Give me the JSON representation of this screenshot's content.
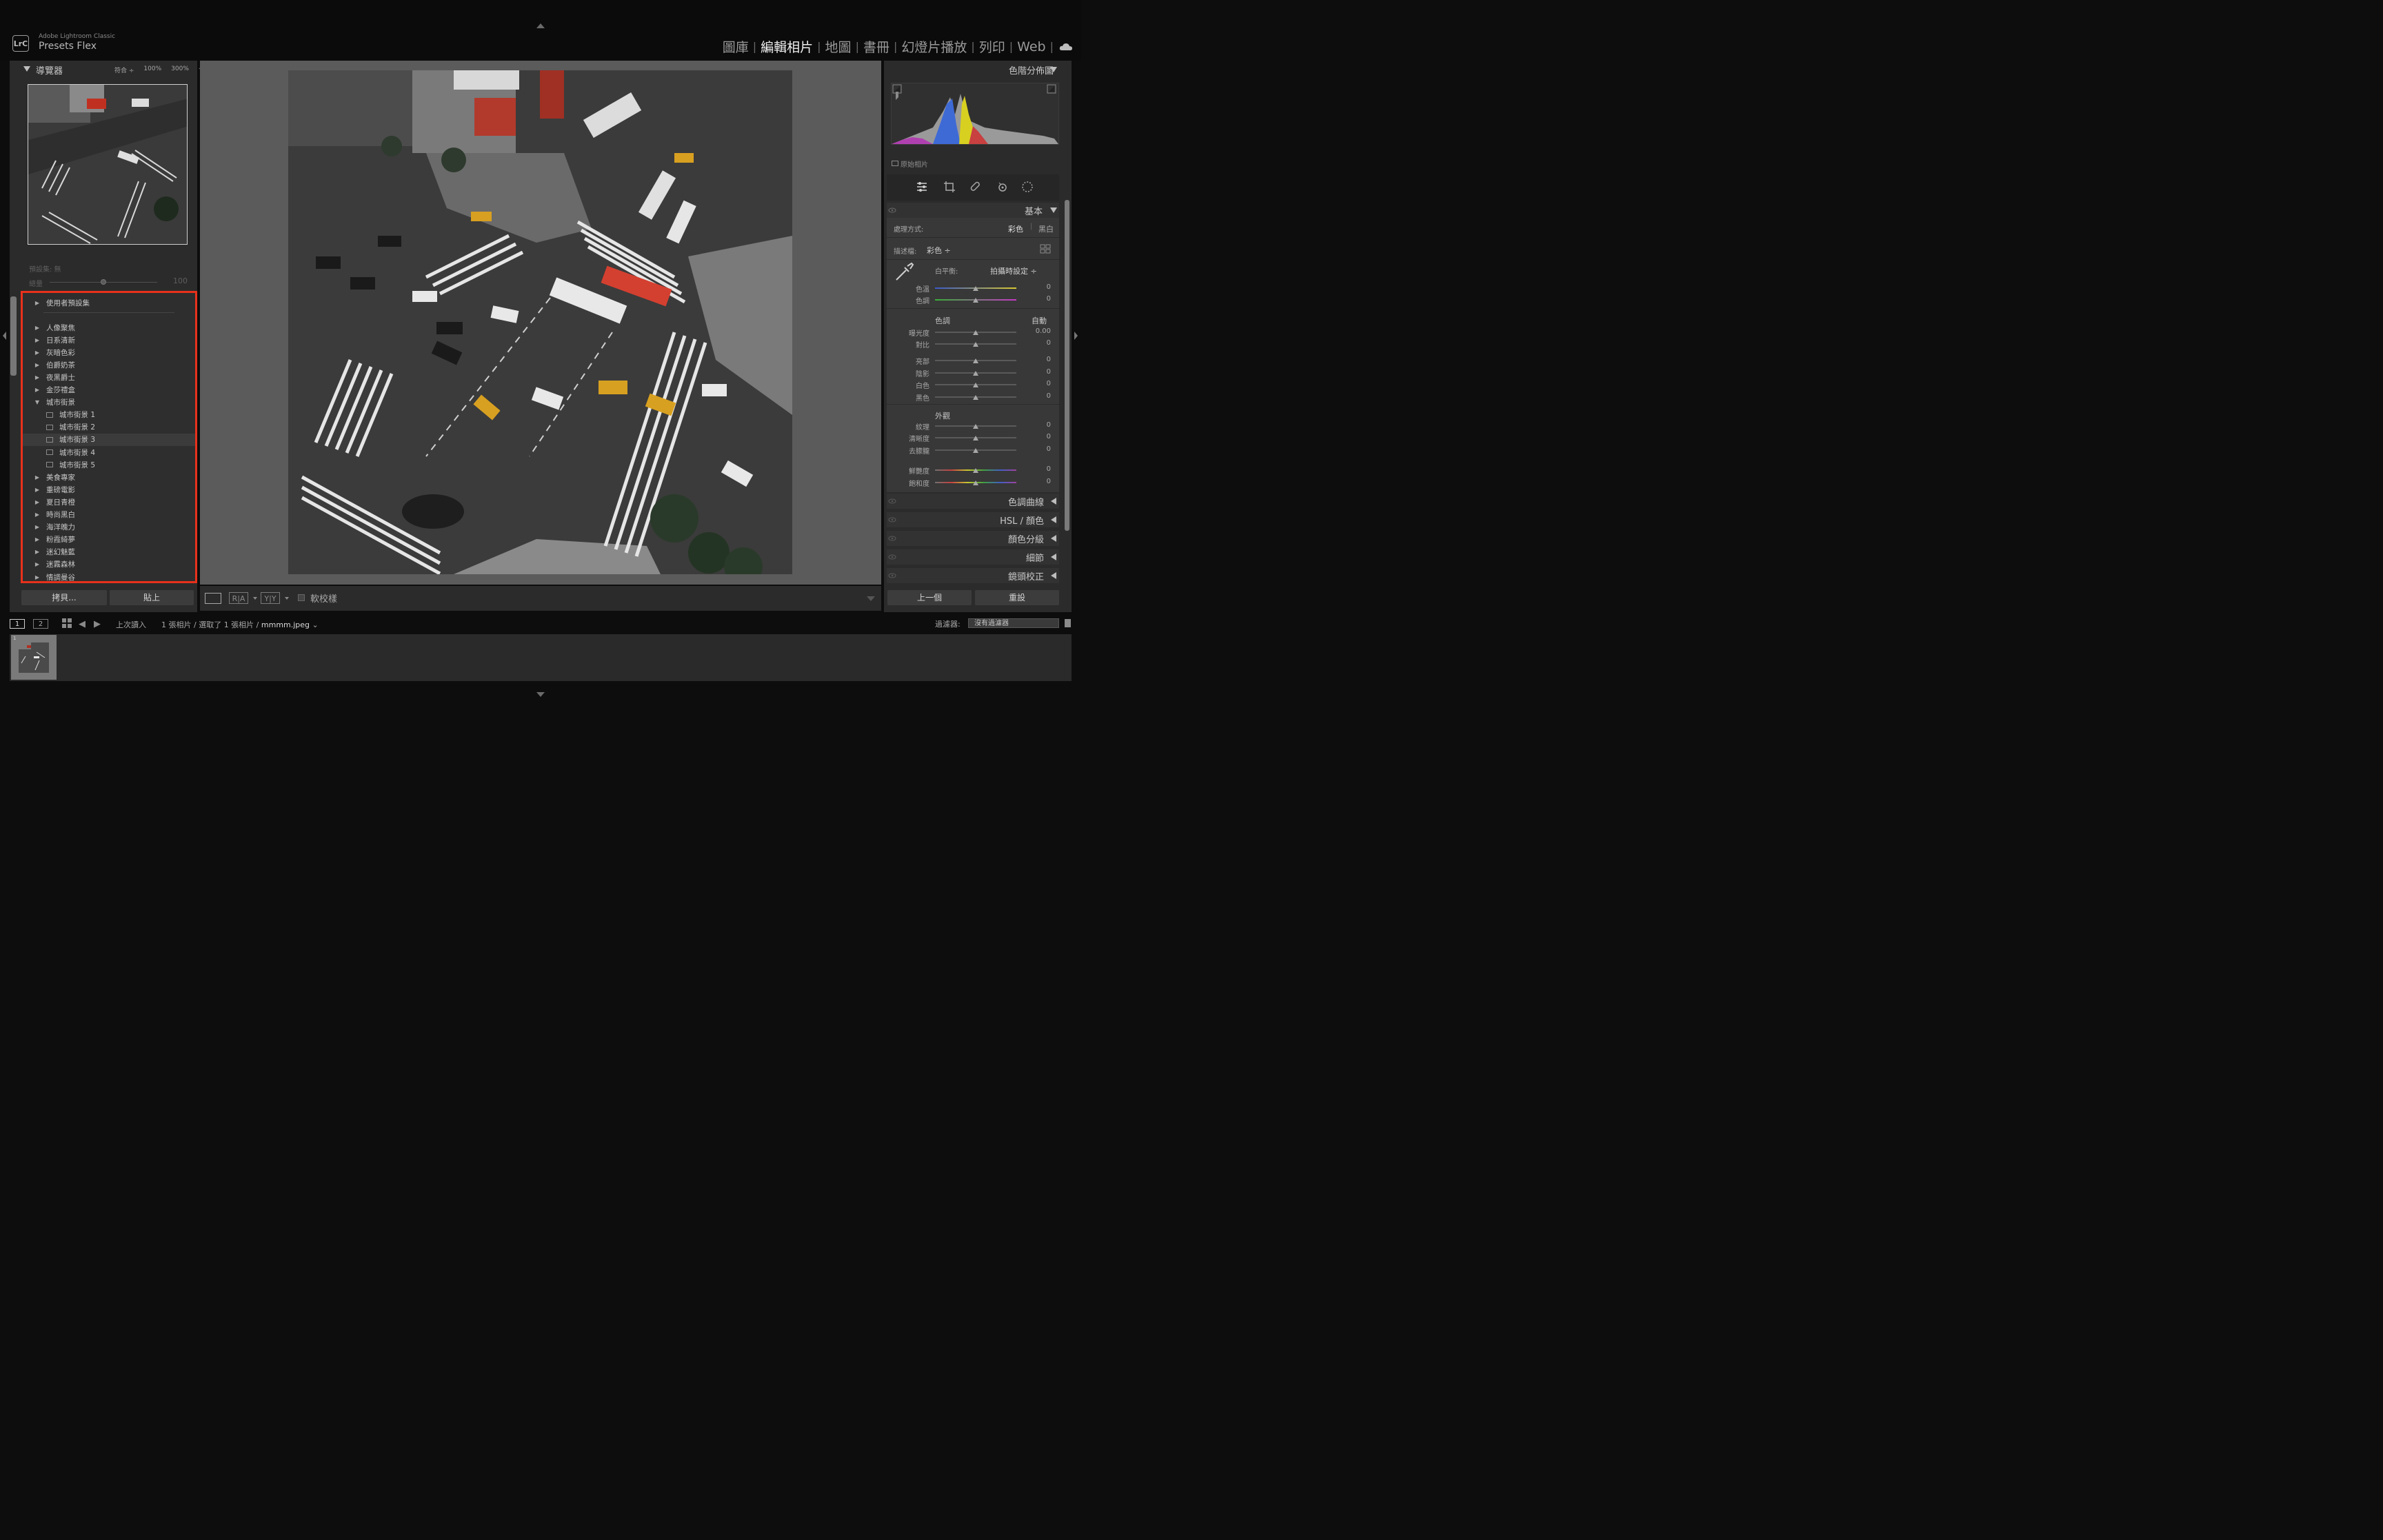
{
  "app": {
    "name": "Adobe Lightroom Classic",
    "logo": "LrC",
    "catalog": "Presets Flex"
  },
  "modules": {
    "items": [
      {
        "label": "圖庫",
        "active": false
      },
      {
        "label": "編輯相片",
        "active": true
      },
      {
        "label": "地圖",
        "active": false
      },
      {
        "label": "書冊",
        "active": false
      },
      {
        "label": "幻燈片播放",
        "active": false
      },
      {
        "label": "列印",
        "active": false
      },
      {
        "label": "Web",
        "active": false
      }
    ],
    "separator": "|"
  },
  "navigator": {
    "title": "導覽器",
    "zoom_fit": "符合 ÷",
    "zoom_100": "100%",
    "zoom_300": "300%",
    "zoom_stepper": "÷"
  },
  "preset_amount": {
    "label_set": "預設集: 無",
    "label_amount": "總量",
    "value": "100"
  },
  "presets": {
    "user_presets": "使用者預設集",
    "groups": [
      {
        "label": "人像聚焦",
        "expanded": false
      },
      {
        "label": "日系清新",
        "expanded": false
      },
      {
        "label": "灰暗色彩",
        "expanded": false
      },
      {
        "label": "伯爵奶茶",
        "expanded": false
      },
      {
        "label": "夜黑爵士",
        "expanded": false
      },
      {
        "label": "金莎禮盒",
        "expanded": false
      },
      {
        "label": "城市街景",
        "expanded": true
      }
    ],
    "children": [
      {
        "label": "城市街景 1",
        "selected": false
      },
      {
        "label": "城市街景 2",
        "selected": false
      },
      {
        "label": "城市街景 3",
        "selected": true
      },
      {
        "label": "城市街景 4",
        "selected": false
      },
      {
        "label": "城市街景 5",
        "selected": false
      }
    ],
    "groups_after": [
      {
        "label": "美食專家"
      },
      {
        "label": "重磅電影"
      },
      {
        "label": "夏日青橙"
      },
      {
        "label": "時尚黑白"
      },
      {
        "label": "海洋魄力"
      },
      {
        "label": "粉霞綺夢"
      },
      {
        "label": "迷幻魅藍"
      },
      {
        "label": "迷霧森林"
      },
      {
        "label": "情調曼谷"
      }
    ]
  },
  "left_buttons": {
    "copy": "拷貝...",
    "paste": "貼上"
  },
  "toolbar": {
    "ra": "R|A",
    "yy": "Y|Y",
    "soft_proof": "軟校樣"
  },
  "histogram": {
    "title": "色階分佈圖",
    "original_photo": "原始相片"
  },
  "basic": {
    "title": "基本",
    "treatment_label": "處理方式:",
    "treatment_color": "彩色",
    "treatment_bw": "黑白",
    "profile_label": "描述檔:",
    "profile_value": "彩色 ÷",
    "wb_label": "白平衡:",
    "wb_value": "拍攝時設定 ÷",
    "tone_title": "色調",
    "auto": "自動",
    "presence_title": "外觀",
    "sliders": [
      {
        "label": "色溫",
        "value": "0",
        "pos": 0.5
      },
      {
        "label": "色調",
        "value": "0",
        "pos": 0.5
      },
      {
        "label": "曝光度",
        "value": "0.00",
        "pos": 0.5
      },
      {
        "label": "對比",
        "value": "0",
        "pos": 0.5
      },
      {
        "label": "亮部",
        "value": "0",
        "pos": 0.5
      },
      {
        "label": "陰影",
        "value": "0",
        "pos": 0.5
      },
      {
        "label": "白色",
        "value": "0",
        "pos": 0.5
      },
      {
        "label": "黑色",
        "value": "0",
        "pos": 0.5
      },
      {
        "label": "紋理",
        "value": "0",
        "pos": 0.5
      },
      {
        "label": "清晰度",
        "value": "0",
        "pos": 0.5
      },
      {
        "label": "去朦朧",
        "value": "0",
        "pos": 0.5
      },
      {
        "label": "鮮艷度",
        "value": "0",
        "pos": 0.5
      },
      {
        "label": "飽和度",
        "value": "0",
        "pos": 0.5
      }
    ]
  },
  "collapsed_sections": [
    {
      "label": "色調曲線"
    },
    {
      "label": "HSL / 顏色"
    },
    {
      "label": "顏色分級"
    },
    {
      "label": "細節"
    },
    {
      "label": "鏡頭校正"
    }
  ],
  "right_buttons": {
    "previous": "上一個",
    "reset": "重設"
  },
  "filmstrip": {
    "screen1": "1",
    "screen2": "2",
    "source": "上次讀入",
    "info": "1 張相片 / 選取了 1 張相片 / ",
    "filename": "mmmm.jpeg",
    "filename_caret": "⌄",
    "filter_label": "過濾器:",
    "filter_value": "沒有過濾器",
    "thumb_number": "1"
  },
  "icons": {
    "cloud": "cloud-icon",
    "grid": "grid-view-icon",
    "back": "back-arrow-icon",
    "forward": "forward-arrow-icon",
    "sliders": "edit-sliders-icon",
    "crop": "crop-icon",
    "heal": "healing-brush-icon",
    "redeye": "red-eye-icon",
    "mask": "masking-icon",
    "eyedropper": "white-balance-eyedropper-icon"
  },
  "colors": {
    "highlight_box": "#e8311b",
    "panel_bg": "#2b2b2b",
    "active_module": "#f0f0f0"
  }
}
